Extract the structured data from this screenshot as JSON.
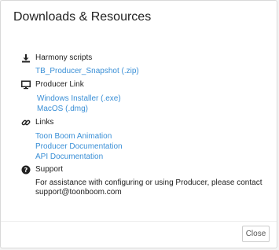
{
  "dialog": {
    "title": "Downloads & Resources",
    "close_label": "Close"
  },
  "sections": {
    "harmony": {
      "icon": "download-icon",
      "label": "Harmony scripts",
      "links": [
        "TB_Producer_Snapshot (.zip)"
      ]
    },
    "producer": {
      "icon": "monitor-icon",
      "label": "Producer Link",
      "links": [
        "Windows Installer (.exe)",
        "MacOS (.dmg)"
      ]
    },
    "links": {
      "icon": "link-icon",
      "label": "Links",
      "links": [
        "Toon Boom Animation",
        "Producer Documentation",
        "API Documentation"
      ]
    },
    "support": {
      "icon": "question-circle-icon",
      "label": "Support",
      "text": "For assistance with configuring or using Producer, please contact support@toonboom.com"
    }
  },
  "colors": {
    "link": "#3a8fd6",
    "text": "#222222"
  }
}
